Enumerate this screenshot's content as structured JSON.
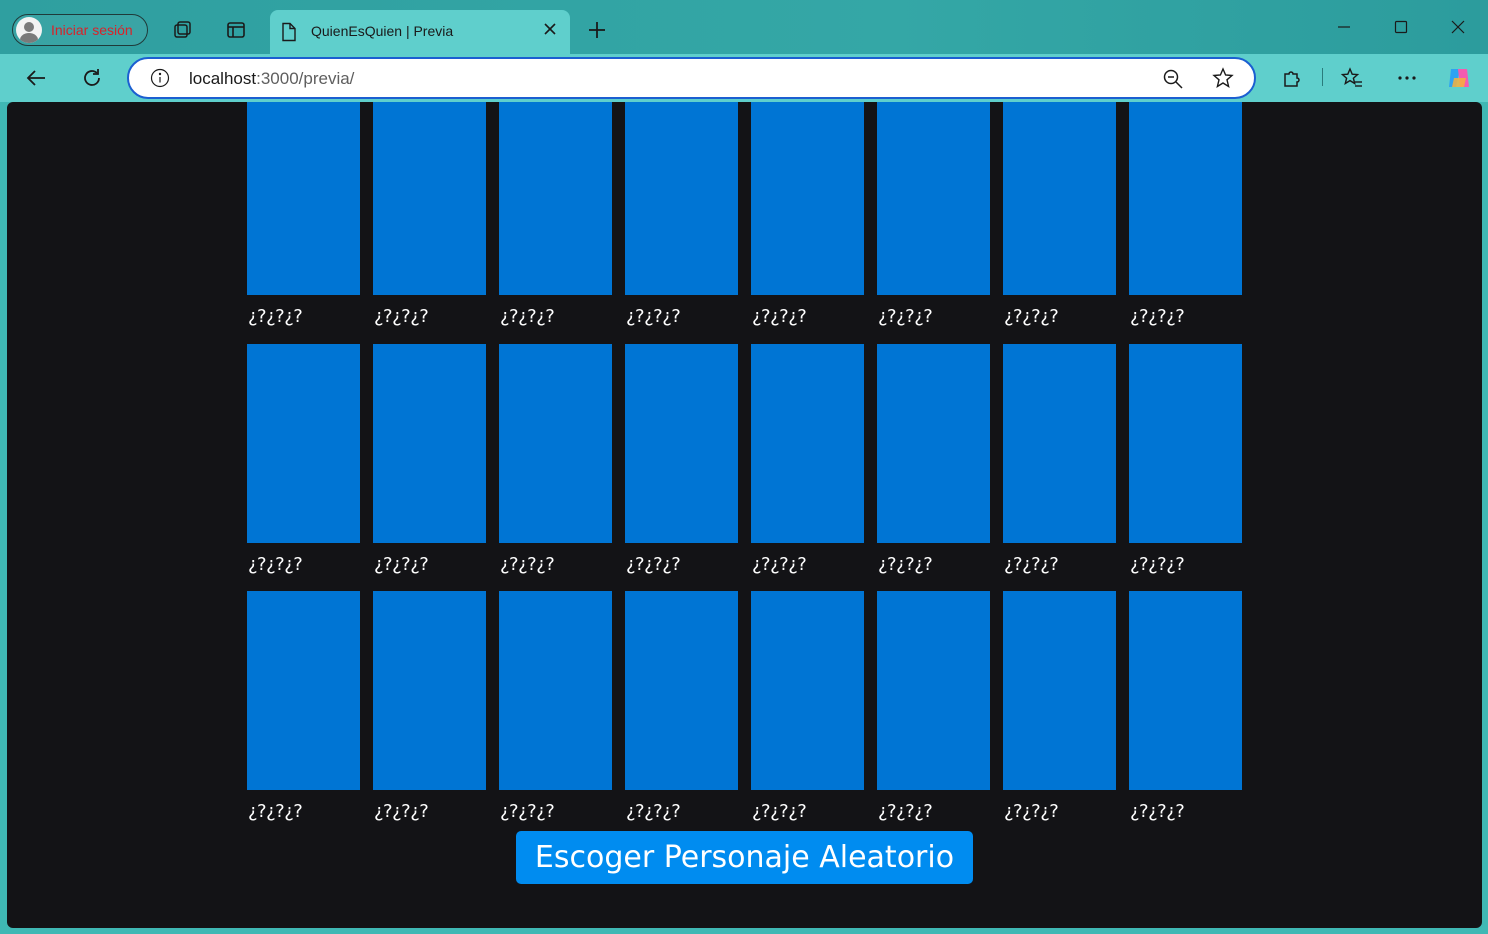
{
  "browser": {
    "profile_label": "Iniciar sesión",
    "tab_title": "QuienEsQuien | Previa",
    "url_host": "localhost",
    "url_path": ":3000/previa/"
  },
  "icons": {
    "profile": "avatar-icon",
    "workspaces": "workspaces-icon",
    "tab_actions": "tab-actions-icon",
    "tab_page": "document-icon",
    "tab_close": "close-icon",
    "new_tab": "plus-icon",
    "minimize": "minimize-icon",
    "maximize": "maximize-icon",
    "close_window": "close-icon",
    "back": "back-arrow-icon",
    "refresh": "refresh-icon",
    "site_info": "info-icon",
    "zoom": "zoom-out-icon",
    "favorite": "star-icon",
    "extensions": "puzzle-icon",
    "favorites_bar": "favorites-icon",
    "more": "more-icon",
    "copilot": "copilot-icon"
  },
  "colors": {
    "card_color": "#0075d4",
    "button_color": "#008cf0",
    "page_background": "#131316",
    "browser_frame": "#5fcfcc"
  },
  "game": {
    "cards": [
      {
        "name": "¿?¿?¿?"
      },
      {
        "name": "¿?¿?¿?"
      },
      {
        "name": "¿?¿?¿?"
      },
      {
        "name": "¿?¿?¿?"
      },
      {
        "name": "¿?¿?¿?"
      },
      {
        "name": "¿?¿?¿?"
      },
      {
        "name": "¿?¿?¿?"
      },
      {
        "name": "¿?¿?¿?"
      },
      {
        "name": "¿?¿?¿?"
      },
      {
        "name": "¿?¿?¿?"
      },
      {
        "name": "¿?¿?¿?"
      },
      {
        "name": "¿?¿?¿?"
      },
      {
        "name": "¿?¿?¿?"
      },
      {
        "name": "¿?¿?¿?"
      },
      {
        "name": "¿?¿?¿?"
      },
      {
        "name": "¿?¿?¿?"
      },
      {
        "name": "¿?¿?¿?"
      },
      {
        "name": "¿?¿?¿?"
      },
      {
        "name": "¿?¿?¿?"
      },
      {
        "name": "¿?¿?¿?"
      },
      {
        "name": "¿?¿?¿?"
      },
      {
        "name": "¿?¿?¿?"
      },
      {
        "name": "¿?¿?¿?"
      },
      {
        "name": "¿?¿?¿?"
      }
    ],
    "random_button_label": "Escoger Personaje Aleatorio"
  }
}
